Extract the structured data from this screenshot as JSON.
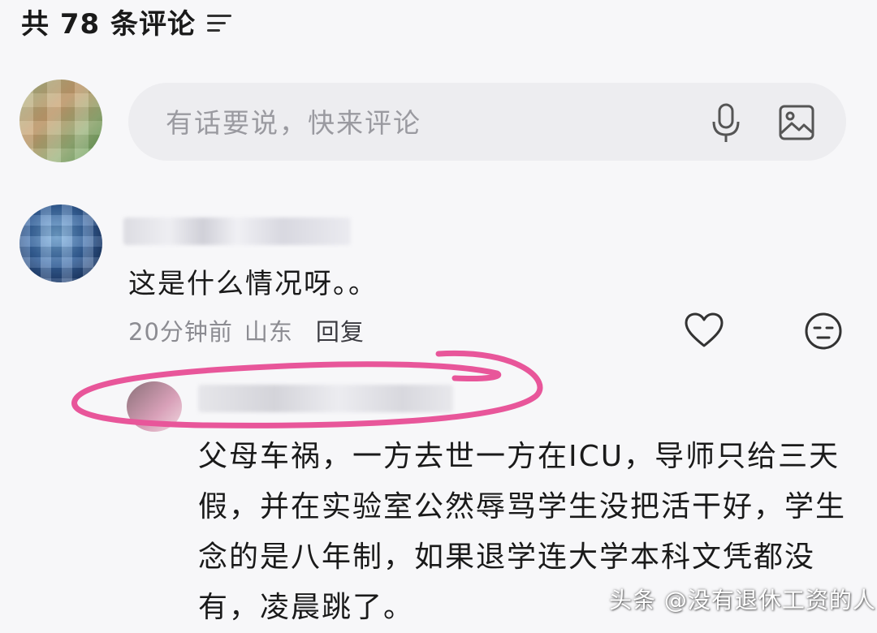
{
  "header": {
    "title": "共 78 条评论",
    "sort_icon": "sort-lines-icon"
  },
  "composer": {
    "placeholder": "有话要说，快来评论",
    "mic_icon": "microphone-icon",
    "image_icon": "image-icon"
  },
  "comments": [
    {
      "text": "这是什么情况呀。。",
      "time": "20分钟前",
      "location": "山东",
      "reply_label": "回复",
      "like_icon": "heart-icon",
      "dislike_icon": "neutral-face-icon"
    },
    {
      "text": "父母车祸，一方去世一方在ICU，导师只给三天假，并在实验室公然辱骂学生没把活干好，学生念的是八年制，如果退学连大学本科文凭都没有，凌晨跳了。"
    }
  ],
  "watermark": "头条 @没有退休工资的人",
  "colors": {
    "highlight": "#e8569a",
    "background": "#f7f7f9",
    "composer_bg": "#ededf0",
    "meta_text": "#8c8c92"
  }
}
